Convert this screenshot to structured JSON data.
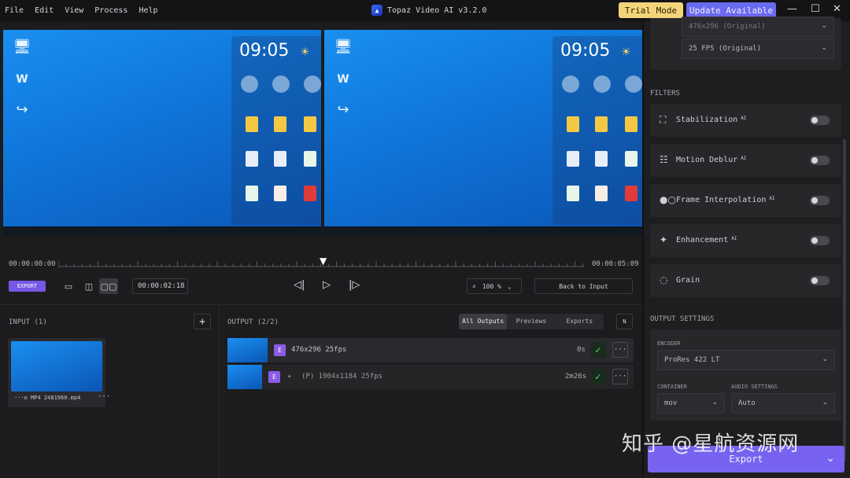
{
  "menu": [
    "File",
    "Edit",
    "View",
    "Process",
    "Help"
  ],
  "app": {
    "title": "Topaz Video AI  v3.2.0"
  },
  "header": {
    "trial": "Trial Mode",
    "update": "Update Available"
  },
  "preview": {
    "clock": "09:05"
  },
  "timeline": {
    "start": "00:00:00:00",
    "end": "00:00:05:09",
    "current": "00:00:02:18"
  },
  "toolbar": {
    "export_label": "EXPORT",
    "zoom": "100 %",
    "back_label": "Back to Input"
  },
  "input": {
    "label": "INPUT (1)",
    "file_name": "···o MP4 2481960.mp4"
  },
  "output": {
    "label": "OUTPUT (2/2)",
    "tabs": [
      "All Outputs",
      "Previews",
      "Exports"
    ],
    "rows": [
      {
        "badge": "E",
        "spec": "476x296  25fps",
        "duration": "0s"
      },
      {
        "badge": "E",
        "spec": "(P)  1904x1184  25fps",
        "duration": "2m26s"
      }
    ]
  },
  "settings": {
    "resolution": "476x296 (Original)",
    "fps": "25 FPS (Original)",
    "filters_label": "FILTERS",
    "filters": [
      {
        "label": "Stabilization",
        "ai": "AI"
      },
      {
        "label": "Motion Deblur",
        "ai": "AI"
      },
      {
        "label": "Frame Interpolation",
        "ai": "AI"
      },
      {
        "label": "Enhancement",
        "ai": "AI"
      },
      {
        "label": "Grain",
        "ai": ""
      }
    ],
    "output_label": "OUTPUT SETTINGS",
    "encoder_label": "ENCODER",
    "encoder": "ProRes 422 LT",
    "container_label": "CONTAINER",
    "container": "mov",
    "audio_label": "AUDIO SETTINGS",
    "audio": "Auto",
    "export_button": "Export"
  },
  "watermark": "知乎 @星航资源网",
  "colors": {
    "accent": "#7763f0",
    "trial": "#f4d47a",
    "update": "#6a6af0",
    "badge": "#8a5ce6"
  }
}
